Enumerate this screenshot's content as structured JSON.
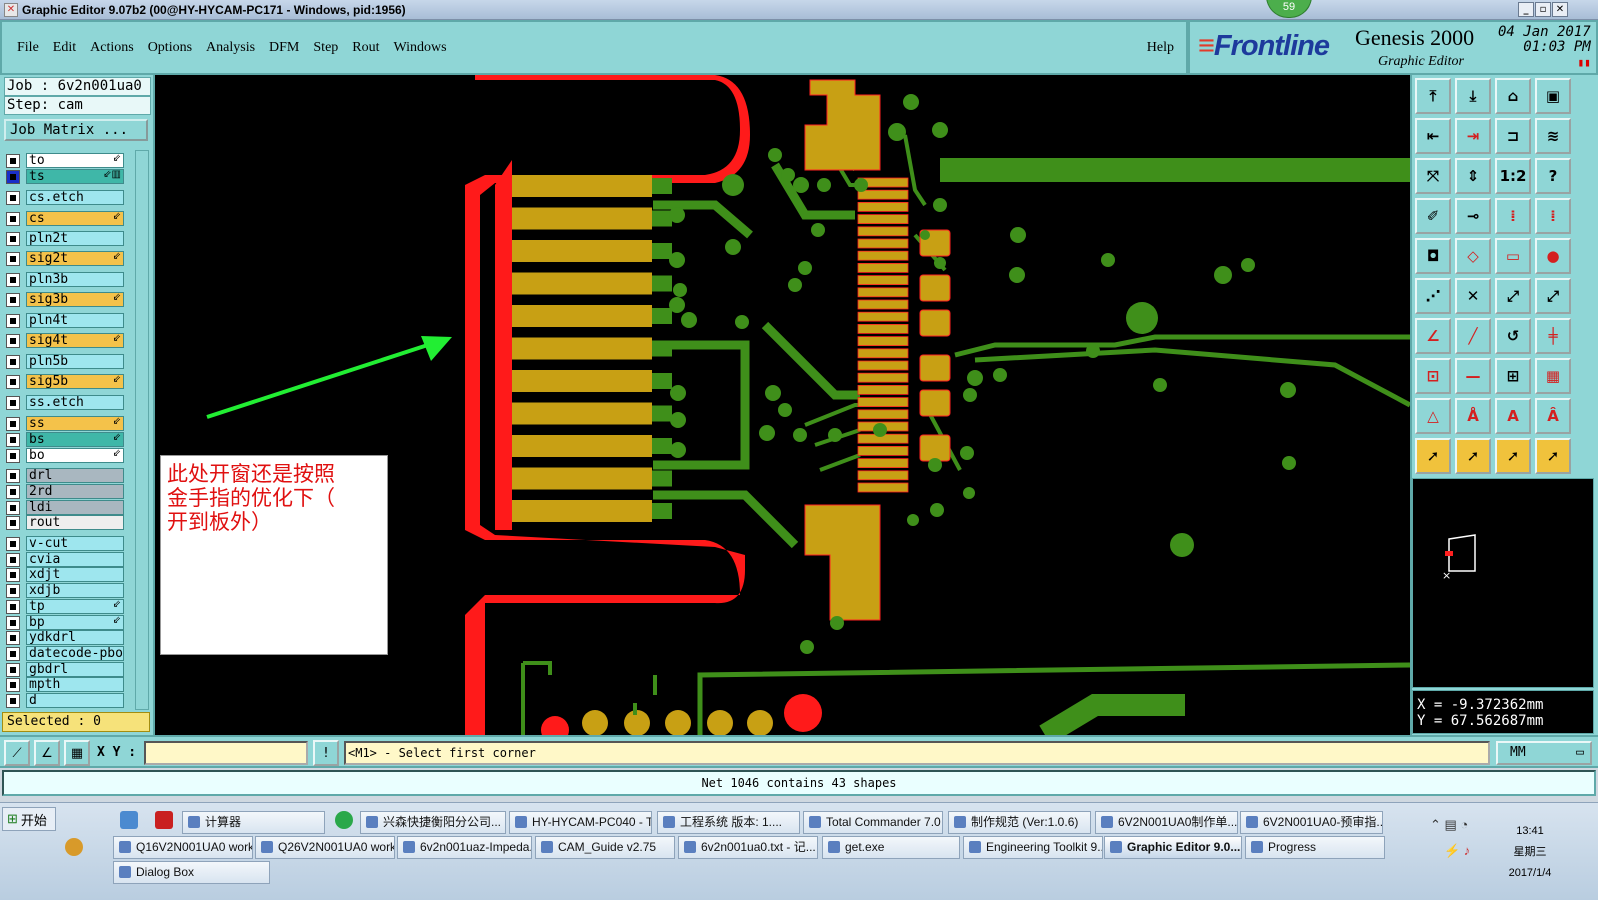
{
  "window": {
    "title": "Graphic Editor 9.07b2 (00@HY-HYCAM-PC171 - Windows, pid:1956)",
    "badge": "59"
  },
  "menu": [
    "File",
    "Edit",
    "Actions",
    "Options",
    "Analysis",
    "DFM",
    "Step",
    "Rout",
    "Windows"
  ],
  "help": "Help",
  "brand": {
    "logo": "Frontline",
    "product": "Genesis 2000",
    "subtitle": "Graphic Editor",
    "date": "04 Jan 2017",
    "time": "01:03 PM"
  },
  "job": {
    "job_line": "Job : 6v2n001ua0",
    "step_line": "Step: cam",
    "matrix_button": "Job Matrix ..."
  },
  "layers": [
    {
      "name": "to",
      "color": "#ffffff",
      "mark": "⇙"
    },
    {
      "name": "ts",
      "color": "#3fb7a8",
      "mark": "⇙▥",
      "active": true
    },
    {
      "name": "cs.etch",
      "color": "#9ee6ee",
      "mark": ""
    },
    {
      "name": "cs",
      "color": "#f4c24a",
      "mark": "⇙"
    },
    {
      "name": "pln2t",
      "color": "#9ee6ee",
      "mark": ""
    },
    {
      "name": "sig2t",
      "color": "#f4c24a",
      "mark": "⇙"
    },
    {
      "name": "pln3b",
      "color": "#9ee6ee",
      "mark": ""
    },
    {
      "name": "sig3b",
      "color": "#f4c24a",
      "mark": "⇙"
    },
    {
      "name": "pln4t",
      "color": "#9ee6ee",
      "mark": ""
    },
    {
      "name": "sig4t",
      "color": "#f4c24a",
      "mark": "⇙"
    },
    {
      "name": "pln5b",
      "color": "#9ee6ee",
      "mark": ""
    },
    {
      "name": "sig5b",
      "color": "#f4c24a",
      "mark": "⇙"
    },
    {
      "name": "ss.etch",
      "color": "#9ee6ee",
      "mark": ""
    },
    {
      "name": "ss",
      "color": "#f4c24a",
      "mark": "⇙"
    },
    {
      "name": "bs",
      "color": "#3fb7a8",
      "mark": "⇙"
    },
    {
      "name": "bo",
      "color": "#ffffff",
      "mark": "⇙"
    },
    {
      "name": "drl",
      "color": "#a9b7c0",
      "mark": ""
    },
    {
      "name": "2rd",
      "color": "#a9b7c0",
      "mark": ""
    },
    {
      "name": "ldi",
      "color": "#a9b7c0",
      "mark": ""
    },
    {
      "name": "rout",
      "color": "#eeeeee",
      "mark": ""
    },
    {
      "name": "v-cut",
      "color": "#9ee6ee",
      "mark": ""
    },
    {
      "name": "cvia",
      "color": "#9ee6ee",
      "mark": ""
    },
    {
      "name": "xdjt",
      "color": "#9ee6ee",
      "mark": ""
    },
    {
      "name": "xdjb",
      "color": "#9ee6ee",
      "mark": ""
    },
    {
      "name": "tp",
      "color": "#9ee6ee",
      "mark": "⇙"
    },
    {
      "name": "bp",
      "color": "#9ee6ee",
      "mark": "⇙"
    },
    {
      "name": "ydkdrl",
      "color": "#9ee6ee",
      "mark": ""
    },
    {
      "name": "datecode-pbo",
      "color": "#9ee6ee",
      "mark": ""
    },
    {
      "name": "gbdrl",
      "color": "#9ee6ee",
      "mark": ""
    },
    {
      "name": "mpth",
      "color": "#9ee6ee",
      "mark": ""
    },
    {
      "name": "d",
      "color": "#9ee6ee",
      "mark": ""
    }
  ],
  "selected": "Selected : 0",
  "note": {
    "lines": [
      "此处开窗还是按照",
      "金手指的优化下（",
      "开到板外）"
    ]
  },
  "colors": {
    "panel": "#8fd6d6",
    "copper": "#c8a014",
    "trace": "#3f8f1a",
    "mask": "#ff1a1a",
    "arrow": "#22ee33"
  },
  "tools": [
    "⤒",
    "⤓",
    "⌂",
    "▣",
    "⇤",
    "⇥",
    "⊐",
    "≋",
    "⤧",
    "⇕",
    "1:2",
    "?",
    "✐",
    "⊸",
    "⁞",
    "⁞",
    "◘",
    "◇",
    "▭",
    "●",
    "⋰",
    "✕",
    "⤢",
    "⤢",
    "∠",
    "╱",
    "↺",
    "╪",
    "⊡",
    "—",
    "⊞",
    "▦",
    "△",
    "Å",
    "A",
    "Â",
    "➚",
    "➚",
    "➚",
    "➚"
  ],
  "coords": {
    "x": "X = -9.372362mm",
    "y": "Y = 67.562687mm"
  },
  "command": {
    "xy_label": "X Y :",
    "xy_value": "",
    "message": "<M1> - Select first corner",
    "units": "MM"
  },
  "net_status": "Net 1046 contains 43 shapes",
  "taskbar": {
    "start": "开始",
    "row1": [
      "计算器",
      "兴森快捷衡阳分公司...",
      "HY-HYCAM-PC040 - T...",
      "工程系统  版本: 1....",
      "Total Commander 7.0 ...",
      "制作规范 (Ver:1.0.6)",
      "6V2N001UA0制作单....",
      "6V2N001UA0-预审指..."
    ],
    "row2": [
      "Q16V2N001UA0 work...",
      "Q26V2N001UA0 work...",
      "6v2n001uaz-Impeda...",
      "CAM_Guide v2.75",
      "6v2n001ua0.txt - 记...",
      "get.exe",
      "Engineering Toolkit 9....",
      "Graphic Editor 9.0...",
      "Progress"
    ],
    "row3": [
      "Dialog Box"
    ],
    "time": "13:41",
    "weekday": "星期三",
    "date": "2017/1/4"
  }
}
